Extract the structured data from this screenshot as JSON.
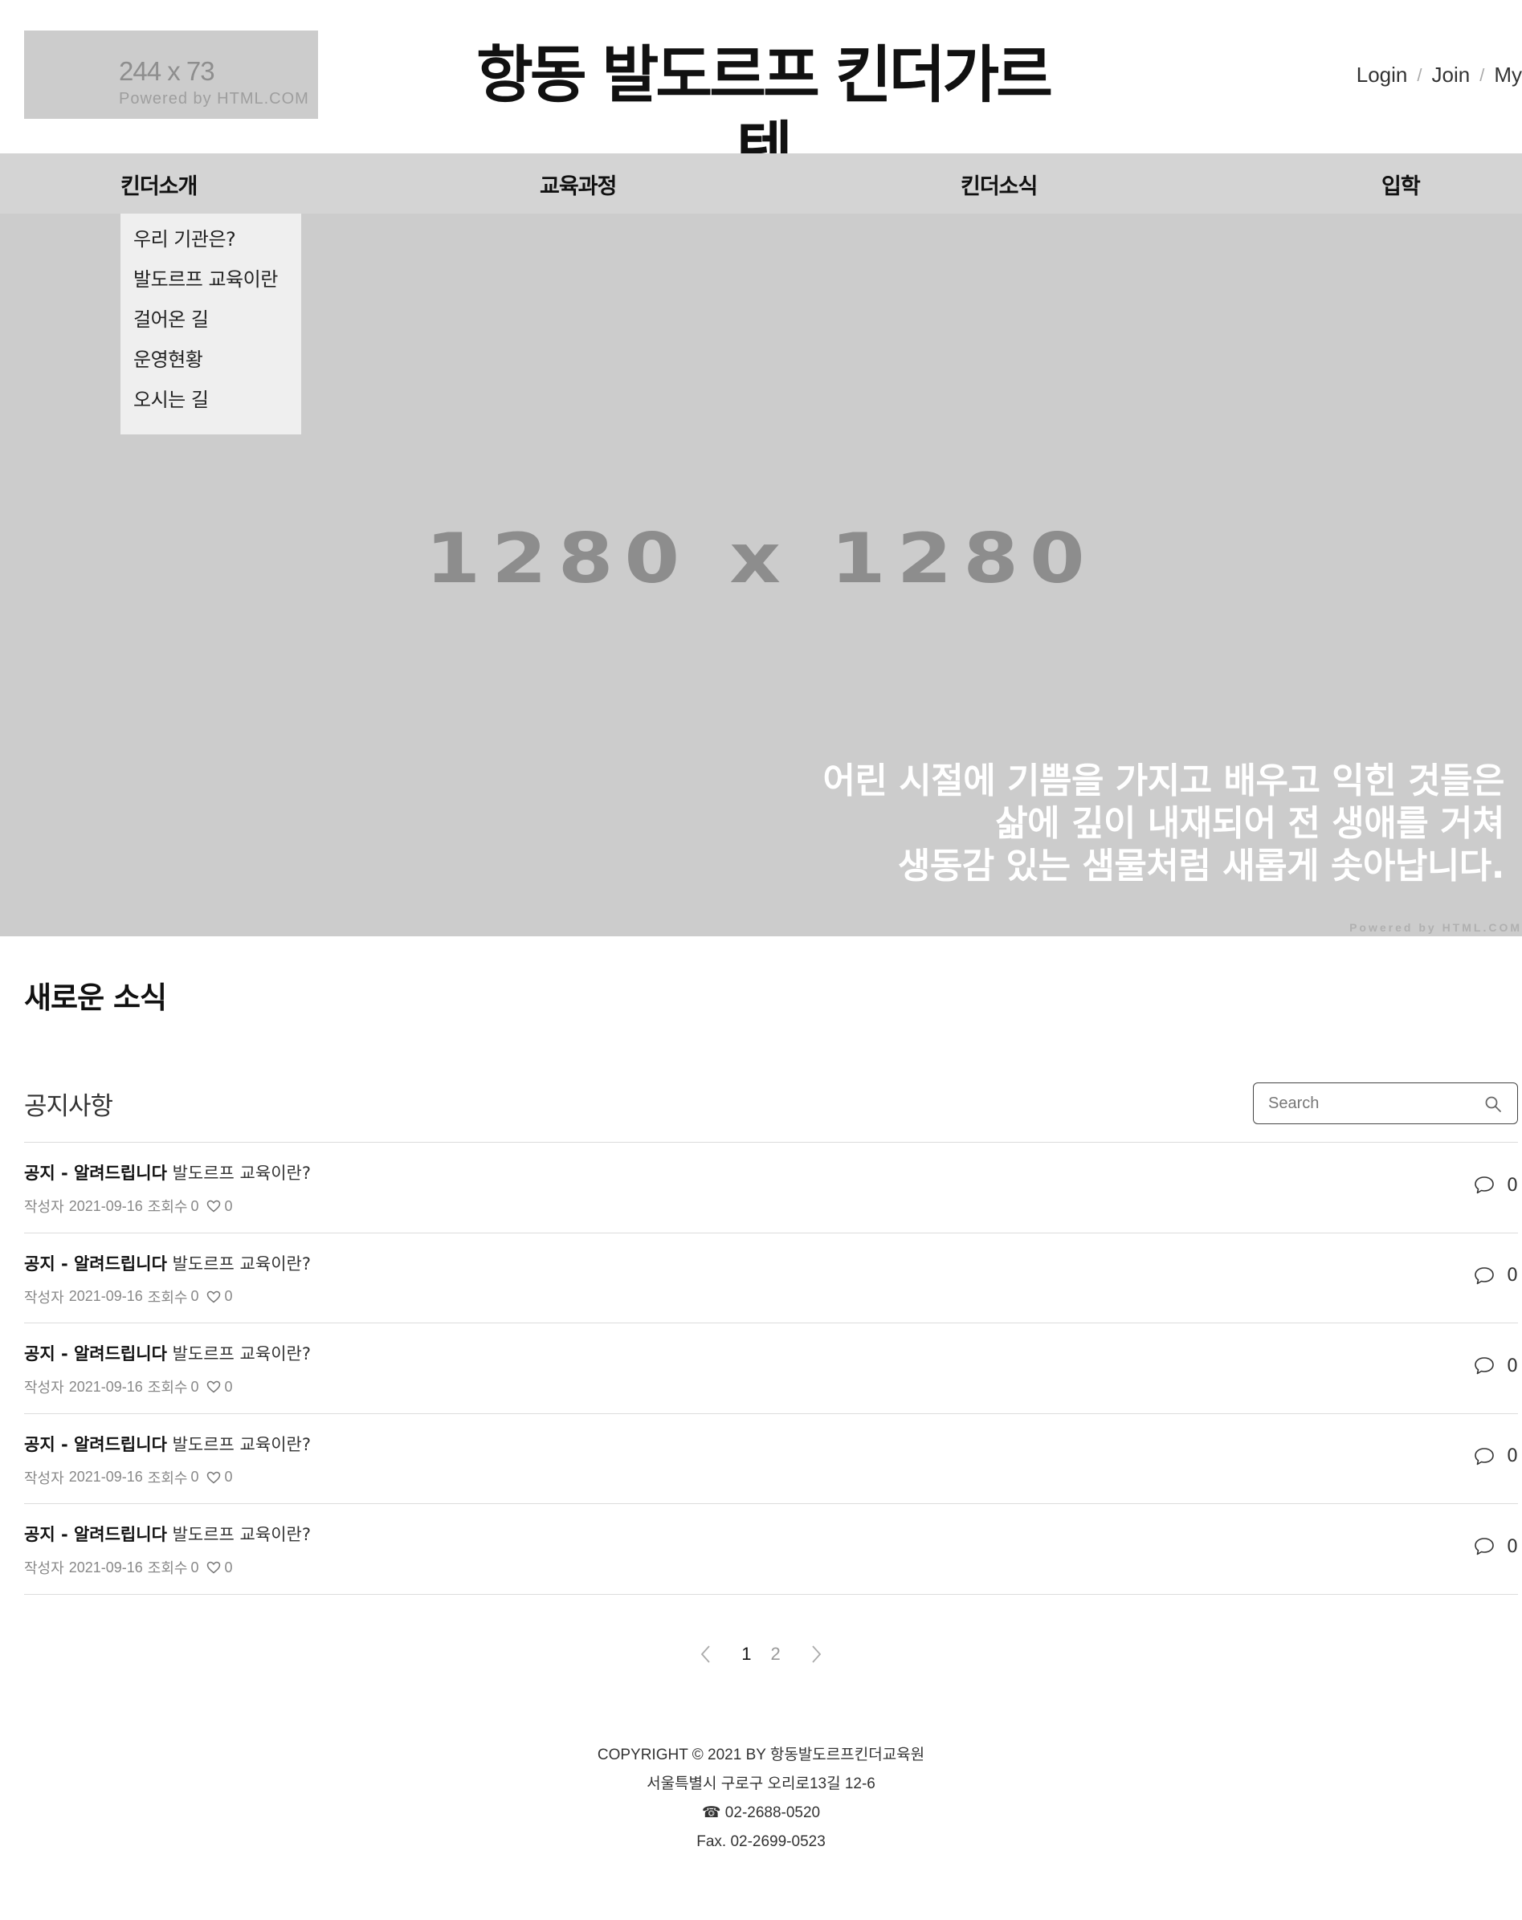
{
  "header": {
    "logo_placeholder": {
      "dimensions": "244 x 73",
      "powered_by": "Powered by HTML.COM"
    },
    "site_title": "항동 발도르프 킨더가르텐",
    "util_links": {
      "login": "Login",
      "join": "Join",
      "my": "My"
    }
  },
  "nav": {
    "items": [
      "킨더소개",
      "교육과정",
      "킨더소식",
      "입학"
    ]
  },
  "dropdown": {
    "items": [
      "우리 기관은?",
      "발도르프 교육이란",
      "걸어온 길",
      "운영현황",
      "오시는 길"
    ]
  },
  "hero": {
    "placeholder_dimensions": "1280 x 1280",
    "powered_by": "Powered by HTML.COM",
    "quote": [
      "어린 시절에 기쁨을 가지고 배우고 익힌 것들은",
      "삶에 깊이 내재되어 전 생애를 거쳐",
      "생동감 있는 샘물처럼 새롭게 솟아납니다."
    ]
  },
  "news": {
    "section_title": "새로운 소식",
    "board_title": "공지사항",
    "search_placeholder": "Search",
    "posts": [
      {
        "category": "공지 - 알려드립니다",
        "title": "발도르프 교육이란?",
        "author": "작성자",
        "date": "2021-09-16",
        "views_label": "조회수",
        "views": "0",
        "likes": "0",
        "comments": "0"
      },
      {
        "category": "공지 - 알려드립니다",
        "title": "발도르프 교육이란?",
        "author": "작성자",
        "date": "2021-09-16",
        "views_label": "조회수",
        "views": "0",
        "likes": "0",
        "comments": "0"
      },
      {
        "category": "공지 - 알려드립니다",
        "title": "발도르프 교육이란?",
        "author": "작성자",
        "date": "2021-09-16",
        "views_label": "조회수",
        "views": "0",
        "likes": "0",
        "comments": "0"
      },
      {
        "category": "공지 - 알려드립니다",
        "title": "발도르프 교육이란?",
        "author": "작성자",
        "date": "2021-09-16",
        "views_label": "조회수",
        "views": "0",
        "likes": "0",
        "comments": "0"
      },
      {
        "category": "공지 - 알려드립니다",
        "title": "발도르프 교육이란?",
        "author": "작성자",
        "date": "2021-09-16",
        "views_label": "조회수",
        "views": "0",
        "likes": "0",
        "comments": "0"
      }
    ]
  },
  "pagination": {
    "pages": [
      "1",
      "2"
    ],
    "current": "1"
  },
  "footer": {
    "copyright": "COPYRIGHT © 2021 BY 항동발도르프킨더교육원",
    "address": "서울특별시 구로구 오리로13길 12-6",
    "phone": "☎ 02-2688-0520",
    "fax": "Fax. 02-2699-0523"
  }
}
